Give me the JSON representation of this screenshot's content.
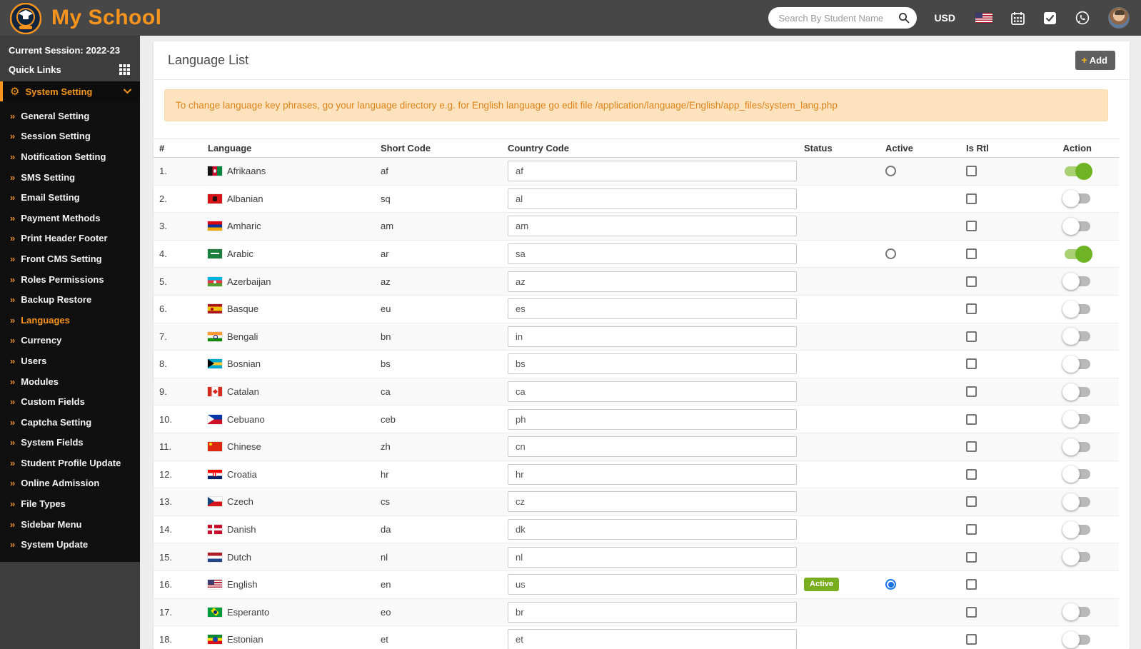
{
  "header": {
    "brand": "My School",
    "search_placeholder": "Search By Student Name",
    "currency_label": "USD",
    "icons": [
      "search-icon",
      "us-flag-icon",
      "calendar-icon",
      "todo-check-icon",
      "whatsapp-icon",
      "user-avatar"
    ]
  },
  "sidebar": {
    "session_label": "Current Session: 2022-23",
    "quick_links_label": "Quick Links",
    "quick_links_icon": "grid-icon",
    "menu_title": "System Setting",
    "menu_icon": "gears-icon",
    "active_item": "Languages",
    "items": [
      "General Setting",
      "Session Setting",
      "Notification Setting",
      "SMS Setting",
      "Email Setting",
      "Payment Methods",
      "Print Header Footer",
      "Front CMS Setting",
      "Roles Permissions",
      "Backup Restore",
      "Languages",
      "Currency",
      "Users",
      "Modules",
      "Custom Fields",
      "Captcha Setting",
      "System Fields",
      "Student Profile Update",
      "Online Admission",
      "File Types",
      "Sidebar Menu",
      "System Update"
    ]
  },
  "main": {
    "title": "Language List",
    "add_button_label": "Add",
    "add_button_plus": "+",
    "notice": "To change language key phrases, go your language directory e.g. for English language go edit file /application/language/English/app_files/system_lang.php",
    "table": {
      "columns": [
        "#",
        "Language",
        "Short Code",
        "Country Code",
        "Status",
        "Active",
        "Is Rtl",
        "Action"
      ],
      "rows": [
        {
          "num": "1.",
          "language": "Afrikaans",
          "flag": "afghanistan",
          "short_code": "af",
          "country_code": "af",
          "status": "",
          "has_radio": true,
          "radio_checked": false,
          "rtl_checked": false,
          "toggle": "on"
        },
        {
          "num": "2.",
          "language": "Albanian",
          "flag": "albania",
          "short_code": "sq",
          "country_code": "al",
          "status": "",
          "has_radio": false,
          "radio_checked": false,
          "rtl_checked": false,
          "toggle": "off"
        },
        {
          "num": "3.",
          "language": "Amharic",
          "flag": "armenia",
          "short_code": "am",
          "country_code": "am",
          "status": "",
          "has_radio": false,
          "radio_checked": false,
          "rtl_checked": false,
          "toggle": "off"
        },
        {
          "num": "4.",
          "language": "Arabic",
          "flag": "saudi-arabia",
          "short_code": "ar",
          "country_code": "sa",
          "status": "",
          "has_radio": true,
          "radio_checked": false,
          "rtl_checked": false,
          "toggle": "on"
        },
        {
          "num": "5.",
          "language": "Azerbaijan",
          "flag": "azerbaijan",
          "short_code": "az",
          "country_code": "az",
          "status": "",
          "has_radio": false,
          "radio_checked": false,
          "rtl_checked": false,
          "toggle": "off"
        },
        {
          "num": "6.",
          "language": "Basque",
          "flag": "spain",
          "short_code": "eu",
          "country_code": "es",
          "status": "",
          "has_radio": false,
          "radio_checked": false,
          "rtl_checked": false,
          "toggle": "off"
        },
        {
          "num": "7.",
          "language": "Bengali",
          "flag": "india",
          "short_code": "bn",
          "country_code": "in",
          "status": "",
          "has_radio": false,
          "radio_checked": false,
          "rtl_checked": false,
          "toggle": "off"
        },
        {
          "num": "8.",
          "language": "Bosnian",
          "flag": "bahamas",
          "short_code": "bs",
          "country_code": "bs",
          "status": "",
          "has_radio": false,
          "radio_checked": false,
          "rtl_checked": false,
          "toggle": "off"
        },
        {
          "num": "9.",
          "language": "Catalan",
          "flag": "canada",
          "short_code": "ca",
          "country_code": "ca",
          "status": "",
          "has_radio": false,
          "radio_checked": false,
          "rtl_checked": false,
          "toggle": "off"
        },
        {
          "num": "10.",
          "language": "Cebuano",
          "flag": "philippines",
          "short_code": "ceb",
          "country_code": "ph",
          "status": "",
          "has_radio": false,
          "radio_checked": false,
          "rtl_checked": false,
          "toggle": "off"
        },
        {
          "num": "11.",
          "language": "Chinese",
          "flag": "china",
          "short_code": "zh",
          "country_code": "cn",
          "status": "",
          "has_radio": false,
          "radio_checked": false,
          "rtl_checked": false,
          "toggle": "off"
        },
        {
          "num": "12.",
          "language": "Croatia",
          "flag": "croatia",
          "short_code": "hr",
          "country_code": "hr",
          "status": "",
          "has_radio": false,
          "radio_checked": false,
          "rtl_checked": false,
          "toggle": "off"
        },
        {
          "num": "13.",
          "language": "Czech",
          "flag": "czech",
          "short_code": "cs",
          "country_code": "cz",
          "status": "",
          "has_radio": false,
          "radio_checked": false,
          "rtl_checked": false,
          "toggle": "off"
        },
        {
          "num": "14.",
          "language": "Danish",
          "flag": "denmark",
          "short_code": "da",
          "country_code": "dk",
          "status": "",
          "has_radio": false,
          "radio_checked": false,
          "rtl_checked": false,
          "toggle": "off"
        },
        {
          "num": "15.",
          "language": "Dutch",
          "flag": "netherlands",
          "short_code": "nl",
          "country_code": "nl",
          "status": "",
          "has_radio": false,
          "radio_checked": false,
          "rtl_checked": false,
          "toggle": "off"
        },
        {
          "num": "16.",
          "language": "English",
          "flag": "usa",
          "short_code": "en",
          "country_code": "us",
          "status": "Active",
          "has_radio": true,
          "radio_checked": true,
          "rtl_checked": false,
          "toggle": "none"
        },
        {
          "num": "17.",
          "language": "Esperanto",
          "flag": "brazil",
          "short_code": "eo",
          "country_code": "br",
          "status": "",
          "has_radio": false,
          "radio_checked": false,
          "rtl_checked": false,
          "toggle": "off"
        },
        {
          "num": "18.",
          "language": "Estonian",
          "flag": "ethiopia",
          "short_code": "et",
          "country_code": "et",
          "status": "",
          "has_radio": false,
          "radio_checked": false,
          "rtl_checked": false,
          "toggle": "off"
        }
      ]
    }
  },
  "colors": {
    "accent_orange": "#f7941d",
    "header_bg": "#474747",
    "sidebar_bg": "#3d3d3d",
    "submenu_bg": "#101010",
    "notice_bg": "#fce3bd",
    "notice_text": "#dd831c",
    "toggle_on_knob": "#6fb424",
    "toggle_on_track": "#a9d173",
    "badge_green": "#78ad20",
    "radio_blue": "#1773e6"
  }
}
